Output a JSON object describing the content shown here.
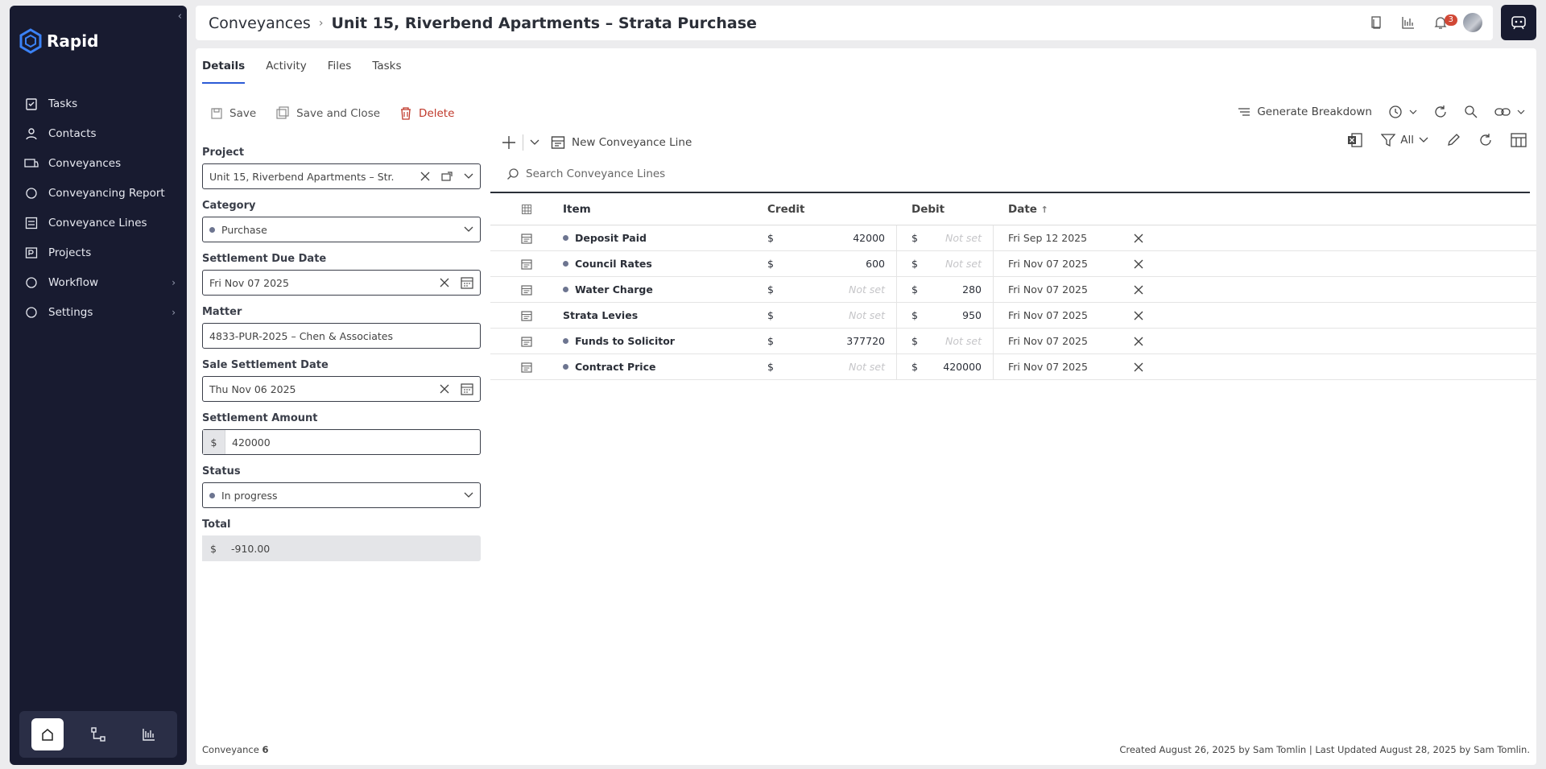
{
  "sidebar": {
    "brand": "Rapid",
    "items": [
      {
        "label": "Tasks"
      },
      {
        "label": "Contacts"
      },
      {
        "label": "Conveyances"
      },
      {
        "label": "Conveyancing Report"
      },
      {
        "label": "Conveyance Lines"
      },
      {
        "label": "Projects"
      },
      {
        "label": "Workflow"
      },
      {
        "label": "Settings"
      }
    ]
  },
  "header": {
    "breadcrumb_parent": "Conveyances",
    "breadcrumb_current": "Unit 15, Riverbend Apartments – Strata Purchase",
    "notification_count": "3"
  },
  "tabs": [
    {
      "label": "Details"
    },
    {
      "label": "Activity"
    },
    {
      "label": "Files"
    },
    {
      "label": "Tasks"
    }
  ],
  "toolbar": {
    "save": "Save",
    "save_close": "Save and Close",
    "delete": "Delete",
    "generate": "Generate Breakdown"
  },
  "form": {
    "project_label": "Project",
    "project_value": "Unit 15, Riverbend Apartments – Str...",
    "category_label": "Category",
    "category_value": "Purchase",
    "settlement_due_label": "Settlement Due Date",
    "settlement_due_value": "Fri Nov 07 2025",
    "matter_label": "Matter",
    "matter_value": "4833-PUR-2025 – Chen & Associates",
    "sale_settlement_label": "Sale Settlement Date",
    "sale_settlement_value": "Thu Nov 06 2025",
    "settlement_amount_label": "Settlement Amount",
    "currency_symbol": "$",
    "settlement_amount_value": "420000",
    "status_label": "Status",
    "status_value": "In progress",
    "total_label": "Total",
    "total_value": "-910.00"
  },
  "grid": {
    "new_line": "New Conveyance Line",
    "filter_label": "All",
    "search_placeholder": "Search Conveyance Lines",
    "columns": {
      "item": "Item",
      "credit": "Credit",
      "debit": "Debit",
      "date": "Date"
    },
    "currency": "$",
    "rows": [
      {
        "item": "Deposit Paid",
        "dot": true,
        "credit": "42000",
        "debit": "Not set",
        "date": "Fri Sep 12 2025"
      },
      {
        "item": "Council Rates",
        "dot": true,
        "credit": "600",
        "debit": "Not set",
        "date": "Fri Nov 07 2025"
      },
      {
        "item": "Water Charge",
        "dot": true,
        "credit": "Not set",
        "debit": "280",
        "date": "Fri Nov 07 2025"
      },
      {
        "item": "Strata Levies",
        "dot": false,
        "credit": "Not set",
        "debit": "950",
        "date": "Fri Nov 07 2025"
      },
      {
        "item": "Funds to Solicitor",
        "dot": true,
        "credit": "377720",
        "debit": "Not set",
        "date": "Fri Nov 07 2025"
      },
      {
        "item": "Contract Price",
        "dot": true,
        "credit": "Not set",
        "debit": "420000",
        "date": "Fri Nov 07 2025"
      }
    ]
  },
  "footer": {
    "record_label": "Conveyance",
    "record_number": "6",
    "audit": "Created August 26, 2025 by Sam Tomlin | Last Updated August 28, 2025 by Sam Tomlin."
  }
}
